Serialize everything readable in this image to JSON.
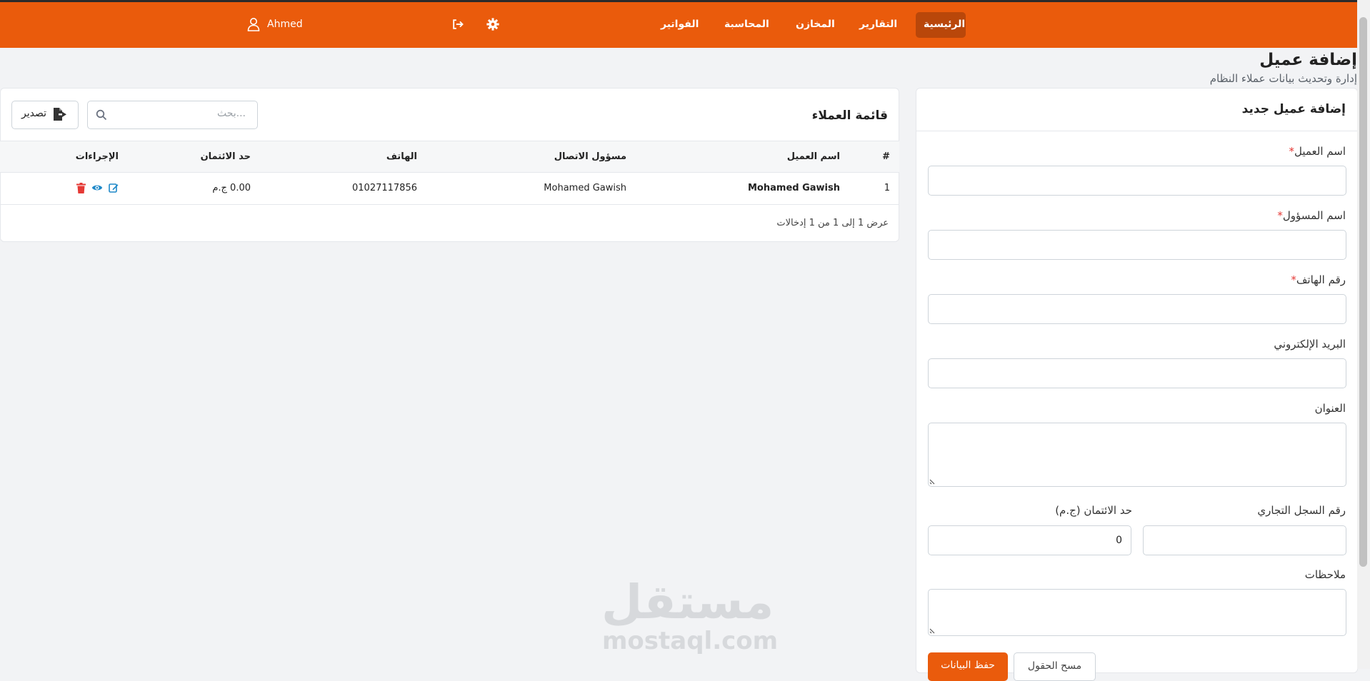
{
  "navbar": {
    "items": [
      "الرئيسية",
      "التقارير",
      "المخازن",
      "المحاسبة",
      "الفواتير"
    ],
    "user_name": "Ahmed"
  },
  "page": {
    "title": "إضافة عميل",
    "subtitle": "إدارة وتحديث بيانات عملاء النظام"
  },
  "customers_list": {
    "title": "قائمة العملاء",
    "search_placeholder": "بحث...",
    "export_label": "تصدير",
    "columns": [
      "#",
      "اسم العميل",
      "مسؤول الاتصال",
      "الهاتف",
      "حد الائتمان",
      "الإجراءات"
    ],
    "rows": [
      {
        "index": "1",
        "name": "Mohamed Gawish",
        "contact": "Mohamed Gawish",
        "phone": "01027117856",
        "credit": "0.00 ج.م"
      }
    ],
    "footer": "عرض 1 إلى 1 من 1 إدخالات"
  },
  "form": {
    "title": "إضافة عميل جديد",
    "required_mark": "*",
    "labels": {
      "customer_name": "اسم العميل",
      "contact_name": "اسم المسؤول",
      "phone": "رقم الهاتف",
      "email": "البريد الإلكتروني",
      "address": "العنوان",
      "commercial_register": "رقم السجل التجاري",
      "credit_limit": "حد الائتمان (ج.م)",
      "notes": "ملاحظات"
    },
    "values": {
      "credit_limit": "0"
    },
    "buttons": {
      "save": "حفظ البيانات",
      "clear": "مسح الحقول"
    }
  },
  "watermark": {
    "arabic": "مستقل",
    "latin": "mostaql.com"
  },
  "colors": {
    "brand": "#ea5b0c",
    "brand_dark": "#b9470a",
    "danger": "#e53935",
    "link": "#1e88c8"
  }
}
